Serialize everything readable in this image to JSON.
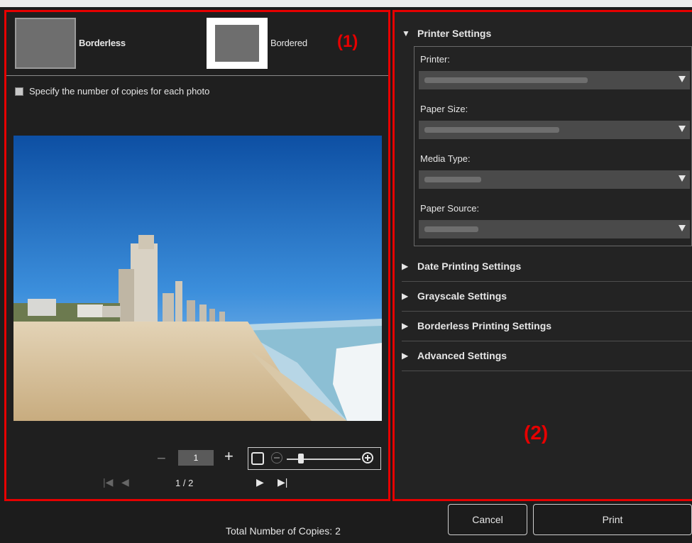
{
  "layouts": {
    "borderless_label": "Borderless",
    "bordered_label": "Bordered"
  },
  "callouts": {
    "one": "(1)",
    "two": "(2)"
  },
  "copies_option": {
    "label": "Specify the number of copies for each photo",
    "checked": false
  },
  "preview": {
    "copies_value": "1",
    "page_indicator": "1 / 2",
    "minus_symbol": "−",
    "plus_symbol": "+"
  },
  "printer_settings": {
    "title": "Printer Settings",
    "expanded": true,
    "fields": [
      {
        "label": "Printer:"
      },
      {
        "label": "Paper Size:"
      },
      {
        "label": "Media Type:"
      },
      {
        "label": "Paper Source:"
      }
    ]
  },
  "collapsed_sections": [
    {
      "title": "Date Printing Settings"
    },
    {
      "title": "Grayscale Settings"
    },
    {
      "title": "Borderless Printing Settings"
    },
    {
      "title": "Advanced Settings"
    }
  ],
  "bottom": {
    "total_copies": "Total Number of Copies: 2",
    "cancel_label": "Cancel",
    "print_label": "Print"
  },
  "colors": {
    "highlight": "#e60000",
    "background": "#1c1c1c"
  }
}
